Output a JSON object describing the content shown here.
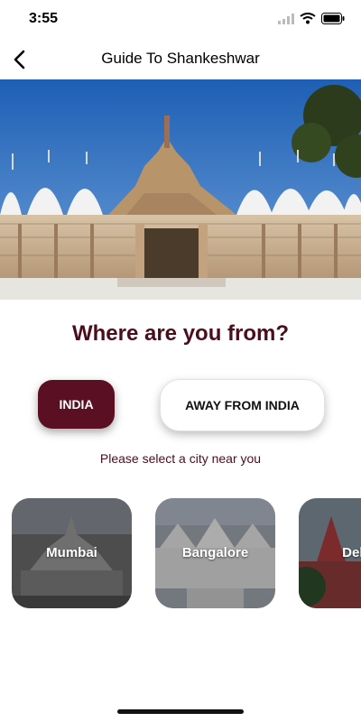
{
  "status": {
    "time": "3:55"
  },
  "header": {
    "title": "Guide To Shankeshwar"
  },
  "main": {
    "question": "Where are you from?",
    "options": {
      "india": "INDIA",
      "away": "AWAY FROM INDIA"
    },
    "hint": "Please select a city near you"
  },
  "cities": [
    {
      "name": "Mumbai"
    },
    {
      "name": "Bangalore"
    },
    {
      "name": "Delhi"
    }
  ],
  "colors": {
    "accent": "#5a0f22",
    "text_accent": "#4a0e1c"
  },
  "icons": [
    "back-icon",
    "signal-icon",
    "wifi-icon",
    "battery-icon"
  ]
}
